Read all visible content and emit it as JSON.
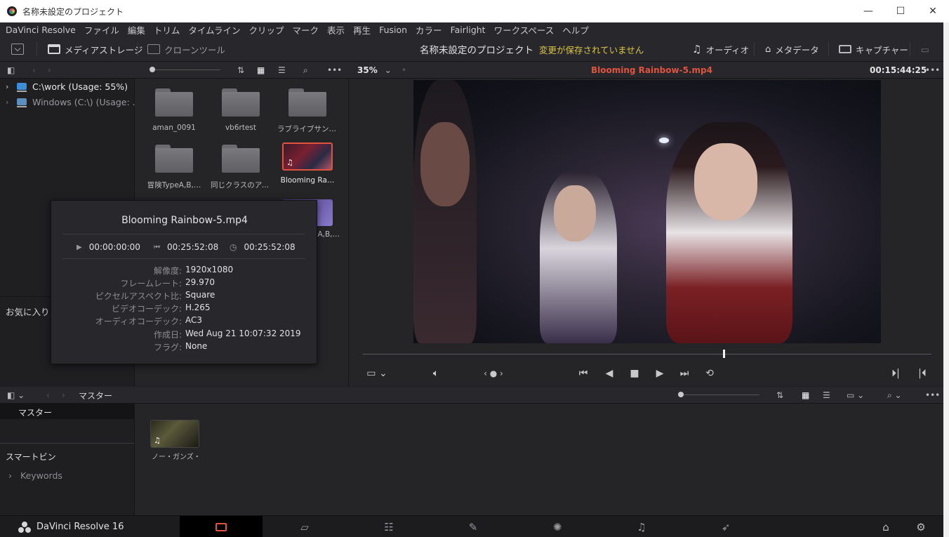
{
  "window": {
    "title": "名称未設定のプロジェクト",
    "min": "—",
    "max": "☐",
    "close": "✕"
  },
  "menu": [
    "DaVinci Resolve",
    "ファイル",
    "編集",
    "トリム",
    "タイムライン",
    "クリップ",
    "マーク",
    "表示",
    "再生",
    "Fusion",
    "カラー",
    "Fairlight",
    "ワークスペース",
    "ヘルプ"
  ],
  "toolbar": {
    "media_storage": "メディアストレージ",
    "clone_tool": "クローンツール",
    "project_name": "名称未設定のプロジェクト",
    "unsaved": "変更が保存されていません",
    "audio": "オーディオ",
    "metadata": "メタデータ",
    "capture": "キャプチャー"
  },
  "storage": {
    "drives": [
      {
        "label": "C:\\work (Usage: 55%)"
      },
      {
        "label": "Windows (C:\\) (Usage: ..."
      }
    ],
    "favorites": "お気に入り",
    "files": [
      {
        "name": "aman_0091",
        "type": "folder"
      },
      {
        "name": "vb6rtest",
        "type": "folder"
      },
      {
        "name": "ラブライブサンシ…",
        "type": "folder"
      },
      {
        "name": "冒険TypeA,B,…",
        "type": "folder"
      },
      {
        "name": "同じクラスのアイ…",
        "type": "folder"
      },
      {
        "name": "Blooming Ra…",
        "type": "video"
      },
      {
        "name": "…A,B,…",
        "type": "video"
      }
    ]
  },
  "popup": {
    "title": "Blooming Rainbow-5.mp4",
    "tc_start": "00:00:00:00",
    "tc_end": "00:25:52:08",
    "tc_duration": "00:25:52:08",
    "meta": [
      {
        "k": "解像度:",
        "v": "1920x1080"
      },
      {
        "k": "フレームレート:",
        "v": "29.970"
      },
      {
        "k": "ピクセルアスペクト比:",
        "v": "Square"
      },
      {
        "k": "ビデオコーデック:",
        "v": "H.265"
      },
      {
        "k": "オーディオコーデック:",
        "v": "AC3"
      },
      {
        "k": "作成日:",
        "v": "Wed Aug 21 10:07:32 2019"
      },
      {
        "k": "フラグ:",
        "v": "None"
      }
    ]
  },
  "viewer": {
    "zoom": "35%",
    "clip_name": "Blooming Rainbow-5.mp4",
    "timecode": "00:15:44:25",
    "playhead_fraction": 0.635
  },
  "bin": {
    "path": "マスター",
    "bins": [
      "マスター"
    ],
    "smart_bin": "スマートビン",
    "keywords": "Keywords",
    "clips": [
      {
        "name": "ノー・ガンズ・…"
      }
    ]
  },
  "pagebar": {
    "app_name": "DaVinci Resolve 16",
    "pages": [
      "media",
      "cut",
      "edit",
      "fusion",
      "color",
      "fairlight",
      "deliver"
    ],
    "active": "media"
  },
  "colors": {
    "accent": "#e0533f",
    "unsaved": "#d9c54a",
    "bg": "#1f1f22",
    "panel": "#28282c"
  }
}
